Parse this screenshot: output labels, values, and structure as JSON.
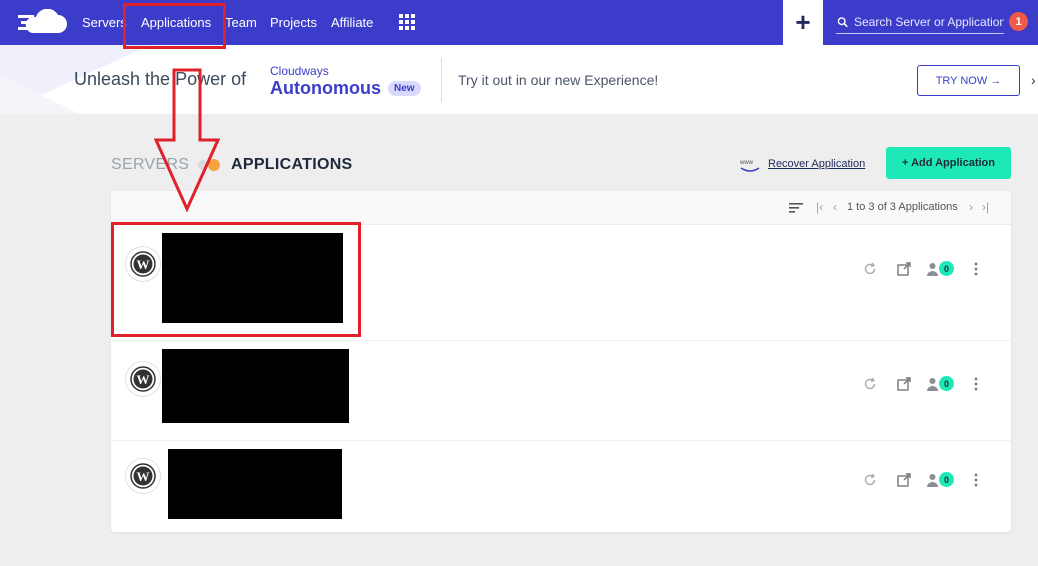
{
  "nav": {
    "items": [
      "Servers",
      "Applications",
      "Team",
      "Projects",
      "Affiliate"
    ],
    "search_placeholder": "Search Server or Application",
    "notification_count": "1"
  },
  "banner": {
    "headline": "Unleash the Power of",
    "brand_small": "Cloudways",
    "brand_big": "Autonomous",
    "new_badge": "New",
    "try_text": "Try it out in our new Experience!",
    "try_button": "TRY NOW →",
    "close": "›"
  },
  "section": {
    "tab_servers": "SERVERS",
    "tab_applications": "APPLICATIONS",
    "recover_link": "Recover Application",
    "add_button": "+ Add Application"
  },
  "list": {
    "pagination_text": "1 to 3 of 3 Applications",
    "rows": [
      {
        "collaborators": "0"
      },
      {
        "collaborators": "0"
      },
      {
        "collaborators": "0"
      }
    ]
  },
  "colors": {
    "nav_bg": "#3b3cc9",
    "accent_green": "#1de9b6",
    "annotation_red": "#e0202a",
    "dot_orange": "#f7a440"
  }
}
